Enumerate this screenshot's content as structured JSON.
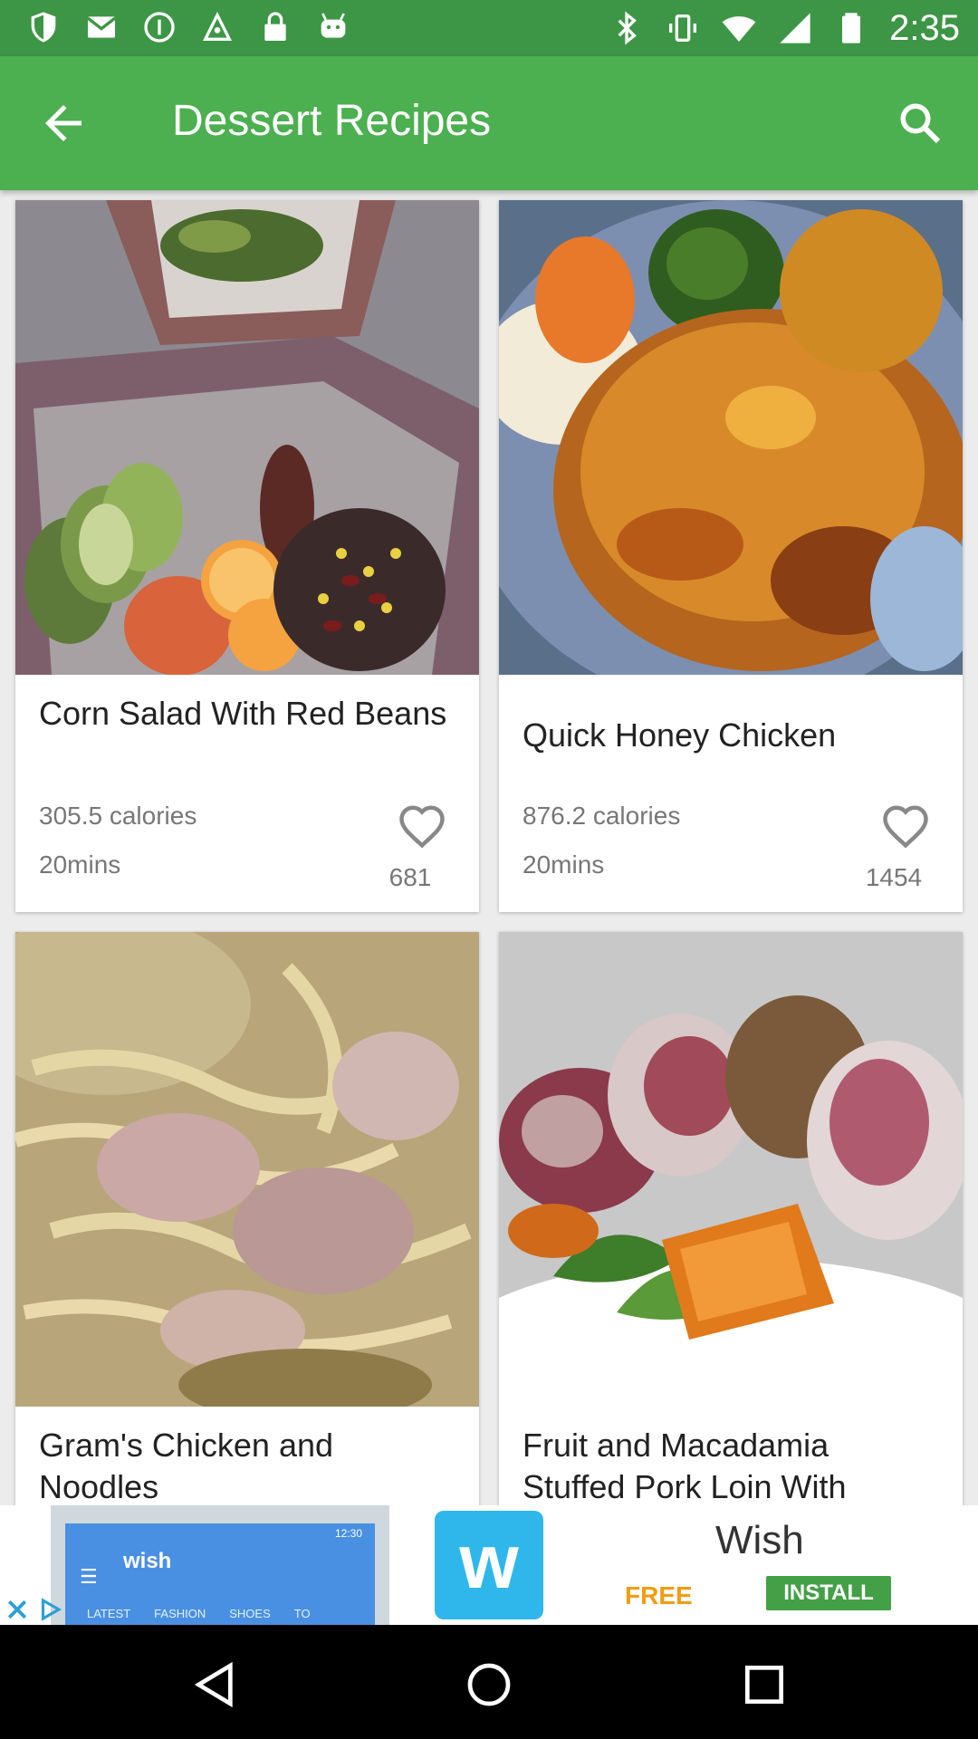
{
  "status_bar": {
    "time": "2:35",
    "left_icons": [
      "shield-icon",
      "mail-icon",
      "info-circle-icon",
      "fake-gps-icon",
      "lock-icon",
      "android-icon"
    ],
    "right_icons": [
      "bluetooth-icon",
      "vibrate-icon",
      "wifi-icon",
      "signal-icon",
      "battery-icon"
    ]
  },
  "app_bar": {
    "title": "Dessert Recipes",
    "color": "#4caf50"
  },
  "recipes": [
    {
      "title": "Corn Salad With Red Beans",
      "calories": "305.5 calories",
      "duration": "20mins",
      "likes": "681"
    },
    {
      "title": "Quick Honey Chicken",
      "calories": "876.2 calories",
      "duration": "20mins",
      "likes": "1454"
    },
    {
      "title": "Gram's Chicken and Noodles"
    },
    {
      "title": "Fruit and Macadamia Stuffed Pork Loin With"
    }
  ],
  "ad": {
    "phone_title": "wish",
    "phone_menu": [
      "LATEST",
      "FASHION",
      "SHOES",
      "TO"
    ],
    "phone_time": "12:30",
    "logo_letter": "w",
    "name": "Wish",
    "free": "FREE",
    "install": "INSTALL"
  }
}
